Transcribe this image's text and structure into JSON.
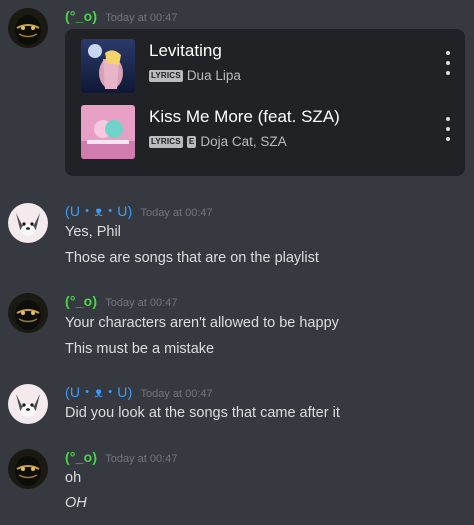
{
  "colors": {
    "background": "#36393f",
    "embed_background": "#202225",
    "green_author": "#4bd34b",
    "blue_author": "#3b9cff",
    "timestamp": "#72767d"
  },
  "messages": [
    {
      "author": "(°_o)",
      "timestamp": "Today at 00:47",
      "avatar": "masked-figure-avatar",
      "embed": {
        "tracks": [
          {
            "title": "Levitating",
            "badges": [
              "LYRICS"
            ],
            "artists": "Dua Lipa",
            "cover": "levitating-album-cover"
          },
          {
            "title": "Kiss Me More (feat. SZA)",
            "badges": [
              "LYRICS",
              "E"
            ],
            "artists": "Doja Cat, SZA",
            "cover": "kiss-me-more-album-cover"
          }
        ]
      }
    },
    {
      "author": "(U・ᴥ・U)",
      "timestamp": "Today at 00:47",
      "avatar": "husky-dog-avatar",
      "lines": [
        "Yes, Phil",
        "Those are songs that are on the playlist"
      ]
    },
    {
      "author": "(°_o)",
      "timestamp": "Today at 00:47",
      "avatar": "masked-figure-avatar",
      "lines": [
        "Your characters aren't allowed to be happy",
        "This must be a mistake"
      ]
    },
    {
      "author": "(U・ᴥ・U)",
      "timestamp": "Today at 00:47",
      "avatar": "husky-dog-avatar",
      "lines": [
        "Did you look at the songs that came after it"
      ]
    },
    {
      "author": "(°_o)",
      "timestamp": "Today at 00:47",
      "avatar": "masked-figure-avatar",
      "lines": [
        "oh",
        "OH"
      ]
    }
  ]
}
